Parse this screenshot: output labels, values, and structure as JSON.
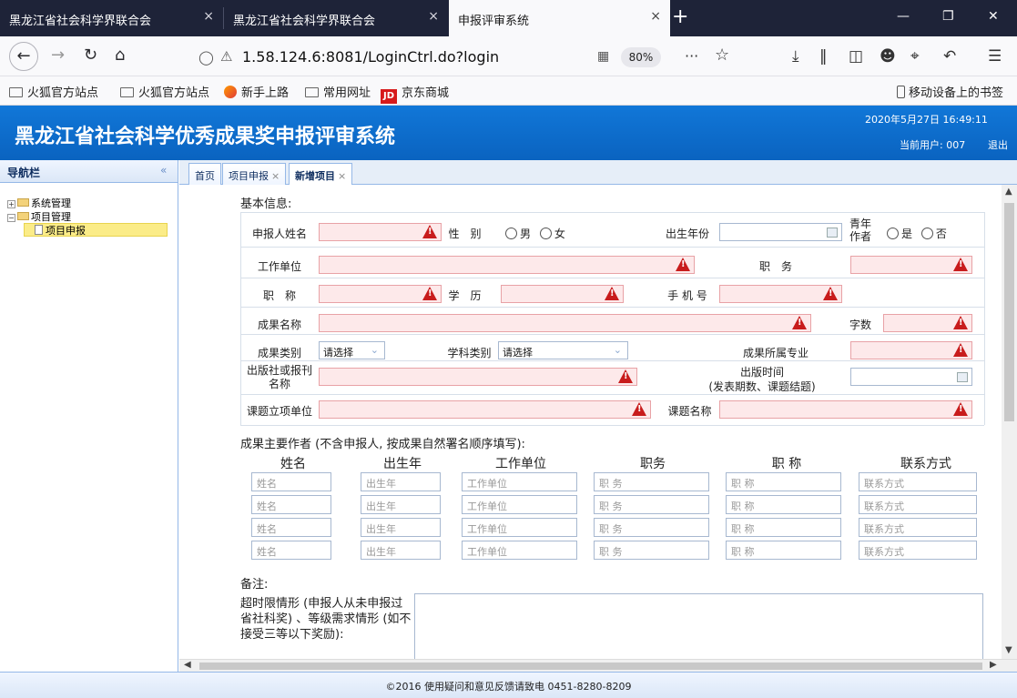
{
  "browser": {
    "tabs": [
      {
        "label": "黑龙江省社会科学界联合会",
        "close": "×"
      },
      {
        "label": "黑龙江省社会科学界联合会",
        "close": "×"
      },
      {
        "label": "申报评审系统",
        "close": "×"
      }
    ],
    "new_tab": "+",
    "window": {
      "minimize": "—",
      "restore": "❐",
      "close": "✕"
    },
    "url": "1.58.124.6:8081/LoginCtrl.do?login",
    "zoom": "80%",
    "bookmarks": [
      "火狐官方站点",
      "火狐官方站点",
      "新手上路",
      "常用网址",
      "京东商城"
    ],
    "mobile_bookmarks": "移动设备上的书签",
    "jd_badge": "JD"
  },
  "app": {
    "title": "黑龙江省社会科学优秀成果奖申报评审系统",
    "datetime": "2020年5月27日 16:49:11",
    "current_user": "当前用户: 007",
    "logout": "退出"
  },
  "nav": {
    "title": "导航栏",
    "collapse": "«",
    "tree": [
      {
        "label": "系统管理",
        "toggle": "+"
      },
      {
        "label": "项目管理",
        "toggle": "−"
      },
      {
        "label": "项目申报"
      }
    ]
  },
  "tabs": [
    {
      "label": "首页"
    },
    {
      "label": "项目申报",
      "close": "×"
    },
    {
      "label": "新增项目",
      "close": "×"
    }
  ],
  "form": {
    "basic_info": "基本信息:",
    "applicant_name": "申报人姓名",
    "gender": "性　别",
    "gender_male": "男",
    "gender_female": "女",
    "birth_year": "出生年份",
    "young_author": "青年作者",
    "young_yes": "是",
    "young_no": "否",
    "work_unit": "工作单位",
    "position": "职　务",
    "title": "职　称",
    "education": "学　历",
    "phone": "手 机 号",
    "achievement_name": "成果名称",
    "word_count": "字数",
    "achievement_category": "成果类别",
    "please_select": "请选择",
    "subject_category": "学科类别",
    "subject_select": "请选择",
    "major": "成果所属专业",
    "publisher": "出版社或报刊名称",
    "publish_time": "出版时间",
    "publish_time_note": "(发表期数、课题结题)",
    "project_unit": "课题立项单位",
    "project_name": "课题名称",
    "authors_section": "成果主要作者 (不含申报人, 按成果自然署名顺序填写):",
    "author_columns": [
      "姓名",
      "出生年",
      "工作单位",
      "职务",
      "职 称",
      "联系方式"
    ],
    "author_placeholders": [
      "姓名",
      "出生年",
      "工作单位",
      "职 务",
      "职 称",
      "联系方式"
    ],
    "remarks": "备注:",
    "remark_text": "超时限情形 (申报人从未申报过省社科奖) 、等级需求情形 (如不接受三等以下奖励):"
  },
  "footer": "©2016 使用疑问和意见反馈请致电 0451-8280-8209",
  "colors": {
    "header_blue": "#0a63c0",
    "required_bg": "#fde9ea",
    "required_border": "#e8a2a6",
    "warn_red": "#c81c1c"
  }
}
